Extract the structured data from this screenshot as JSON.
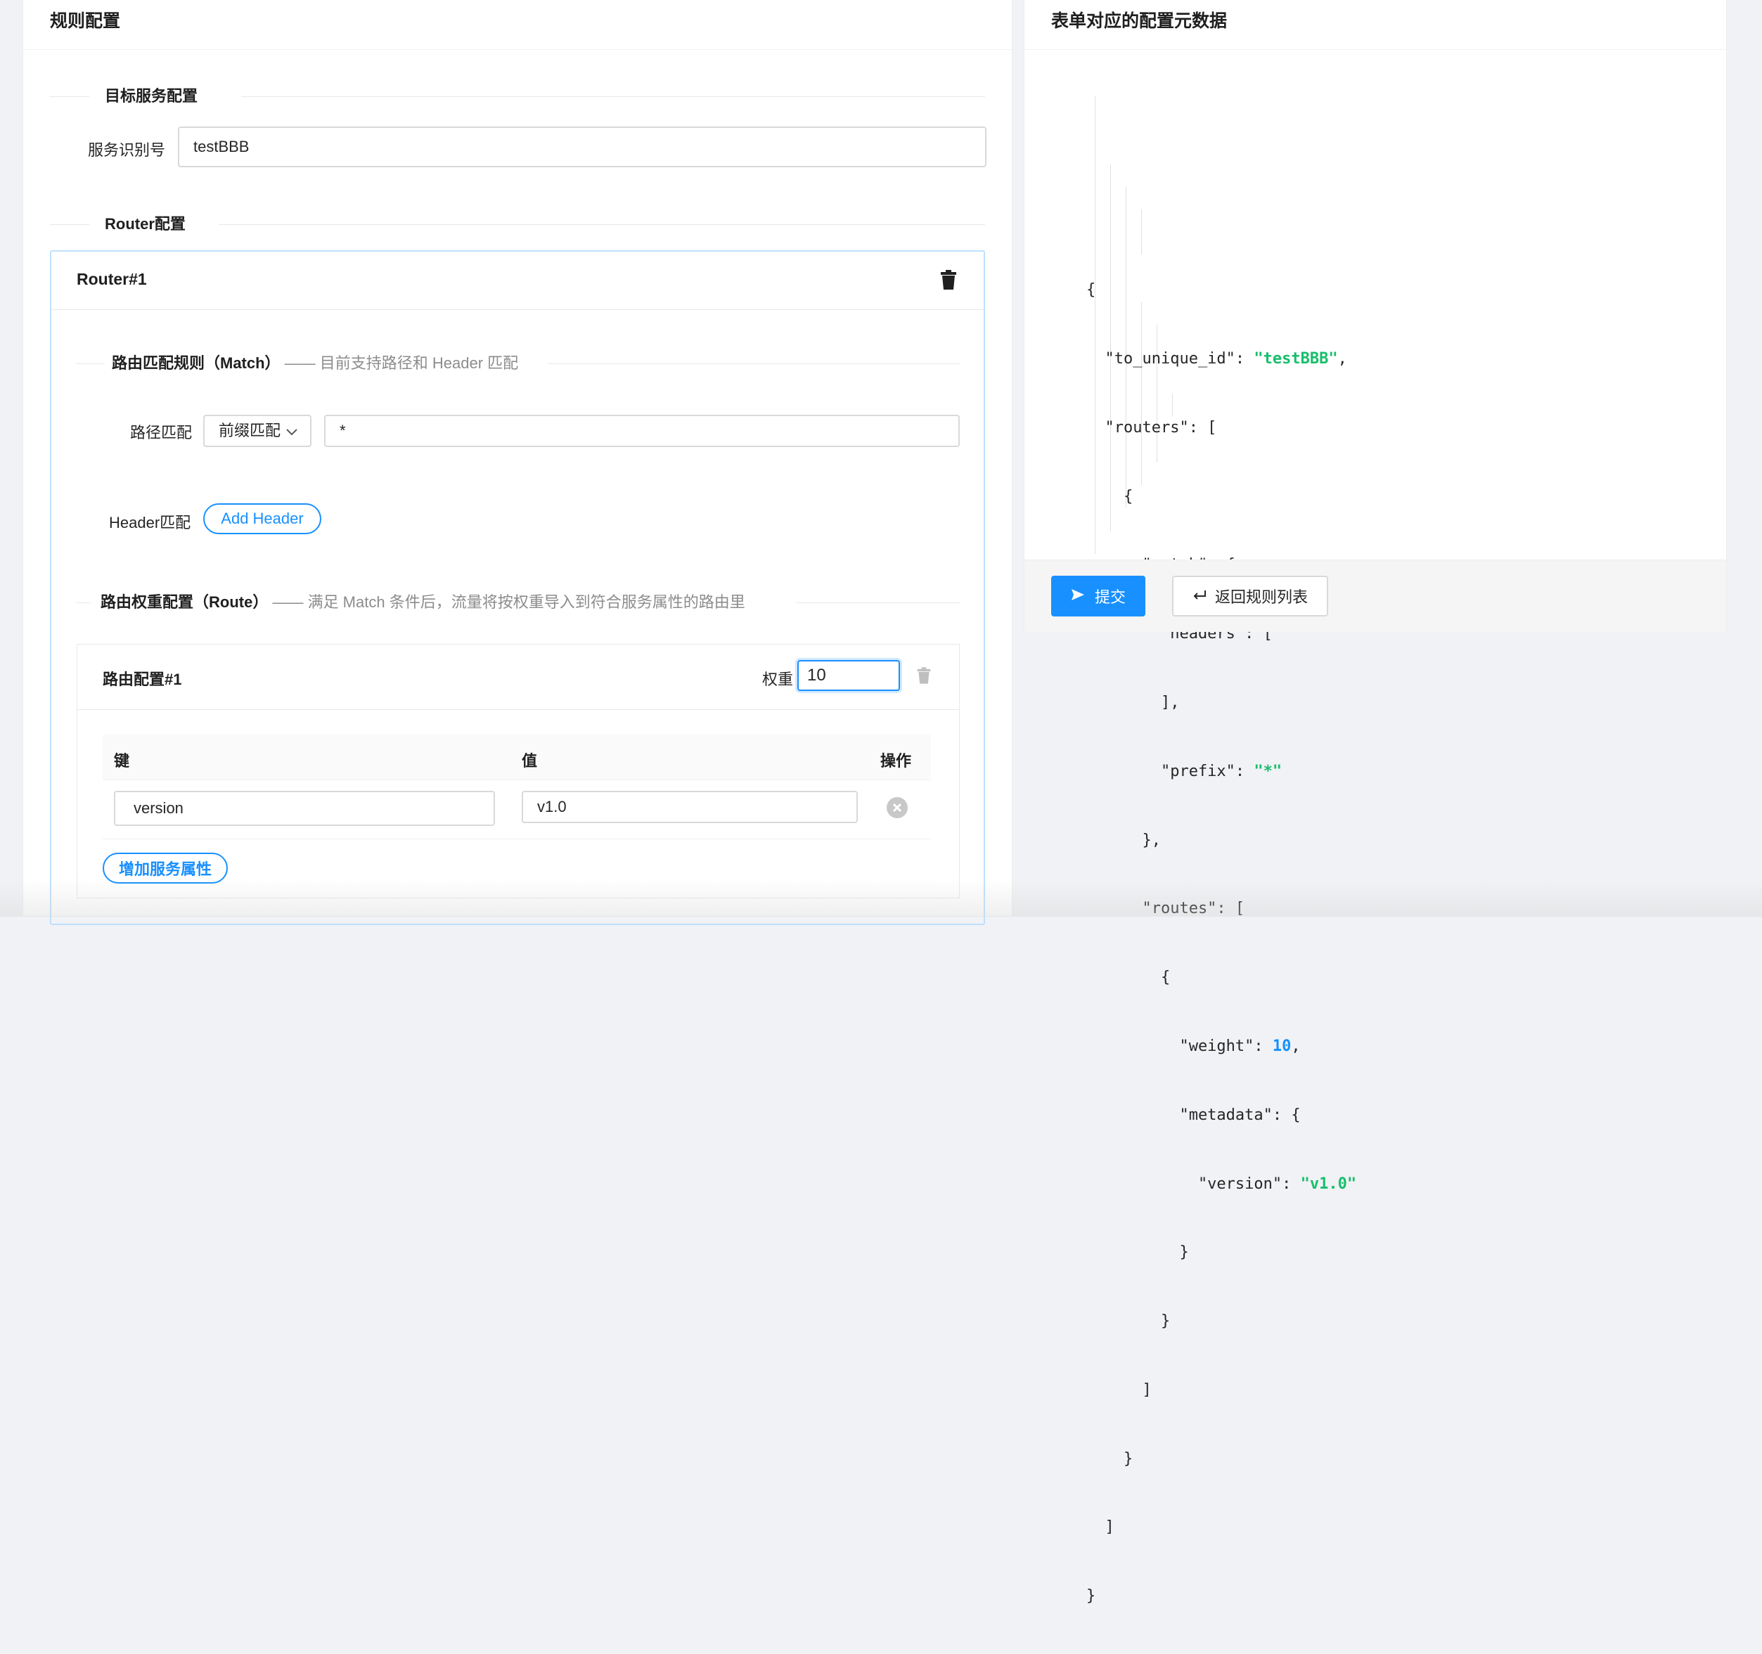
{
  "left_panel": {
    "title": "规则配置",
    "target_section": "目标服务配置",
    "service_id_label": "服务识别号",
    "service_id_value": "testBBB",
    "router_section": "Router配置",
    "router": {
      "title": "Router#1",
      "match_title": "路由匹配规则（Match）",
      "match_desc": "—— 目前支持路径和 Header 匹配",
      "path_label": "路径匹配",
      "path_mode": "前缀匹配",
      "path_value": "*",
      "header_label": "Header匹配",
      "add_header_label": "Add Header",
      "route_title": "路由权重配置（Route）",
      "route_desc": "—— 满足 Match 条件后，流量将按权重导入到符合服务属性的路由里",
      "route": {
        "title": "路由配置#1",
        "weight_label": "权重",
        "weight_value": "10",
        "columns": [
          "键",
          "值",
          "操作"
        ],
        "rows": [
          {
            "key": "version",
            "value": "v1.0"
          }
        ],
        "add_attr_label": "增加服务属性"
      }
    }
  },
  "right_panel": {
    "title": "表单对应的配置元数据",
    "submit_label": "提交",
    "back_label": "返回规则列表"
  },
  "colors": {
    "primary": "#1890ff",
    "json_string": "#19be6b",
    "json_number": "#1890ff"
  },
  "icons": [
    "trash-icon",
    "chevron-down-icon",
    "close-circle-icon",
    "send-icon",
    "enter-icon"
  ]
}
